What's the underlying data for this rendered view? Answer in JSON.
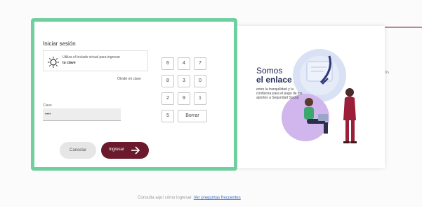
{
  "login": {
    "title": "Iniciar sesión",
    "hint_line1": "Utiliza el teclado virtual para ingresar",
    "hint_line2": "tu clave",
    "forgot_link": "Olvidé mi clave",
    "clave_label": "Clave",
    "clave_value": "••••",
    "keypad": {
      "keys": [
        "6",
        "4",
        "7",
        "8",
        "3",
        "0",
        "2",
        "9",
        "1",
        "5"
      ],
      "clear_label": "Borrar"
    },
    "cancel_label": "Cancelar",
    "submit_label": "Ingresar",
    "accent_color": "#6fcf9f",
    "primary_color": "#6b1a2c"
  },
  "promo": {
    "title_line1": "Somos",
    "title_line2": "el enlace",
    "body": "entre la tranquilidad y la confianza para el pago de los aportes a Seguridad Social."
  },
  "background": {
    "right_fragment": "ns",
    "footer_text": "Consulta aquí cómo ingresar.",
    "footer_link": "Ver preguntas frecuentes"
  }
}
